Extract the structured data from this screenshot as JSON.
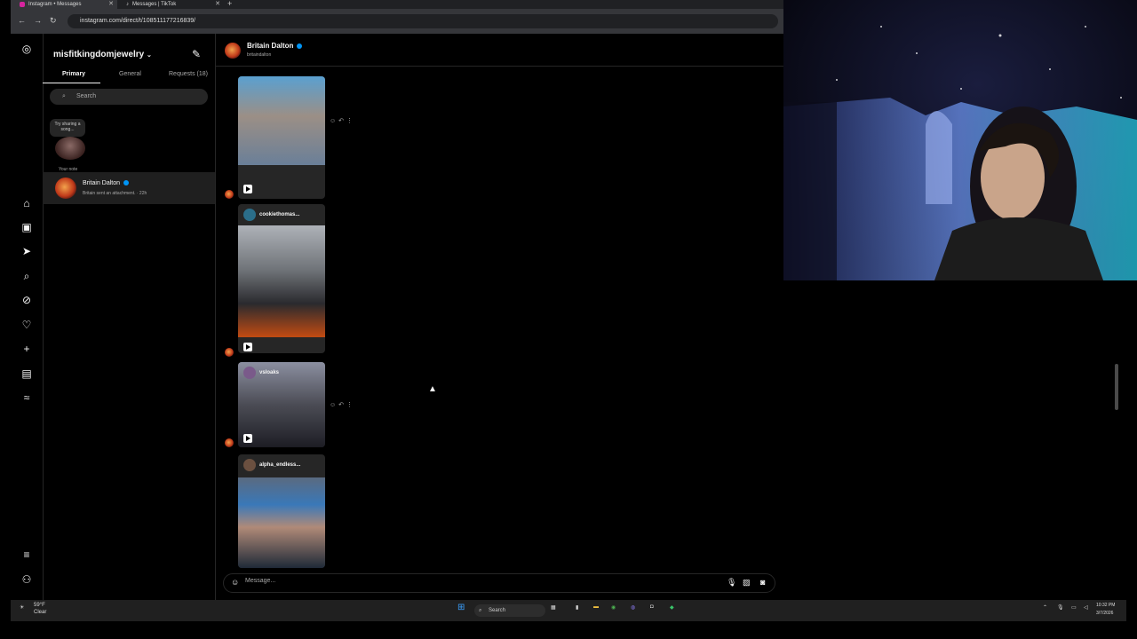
{
  "browser": {
    "tabs": [
      {
        "label": "Instagram • Messages",
        "active": true
      },
      {
        "label": "Messages | TikTok",
        "active": false
      }
    ],
    "url": "instagram.com/direct/t/108511177216839/"
  },
  "inbox": {
    "account": "misfitkingdomjewelry",
    "tabs": [
      "Primary",
      "General",
      "Requests (18)"
    ],
    "search_placeholder": "Search",
    "note_prompt": "Try sharing a song...",
    "note_label": "Your note",
    "conversations": [
      {
        "name": "Britain Dalton",
        "verified": true,
        "preview": "Britain sent an attachment. · 22h"
      }
    ]
  },
  "thread": {
    "name": "Britain Dalton",
    "username": "britaindalton",
    "reels": [
      {
        "author": ""
      },
      {
        "author": "cookiethomas..."
      },
      {
        "author": "vsloaks"
      },
      {
        "author": "alpha_endless..."
      }
    ],
    "message_placeholder": "Message..."
  },
  "taskbar": {
    "weather_temp": "59°F",
    "weather_desc": "Clear",
    "search": "Search",
    "time": "10:32 PM",
    "date": "3/7/2026"
  }
}
